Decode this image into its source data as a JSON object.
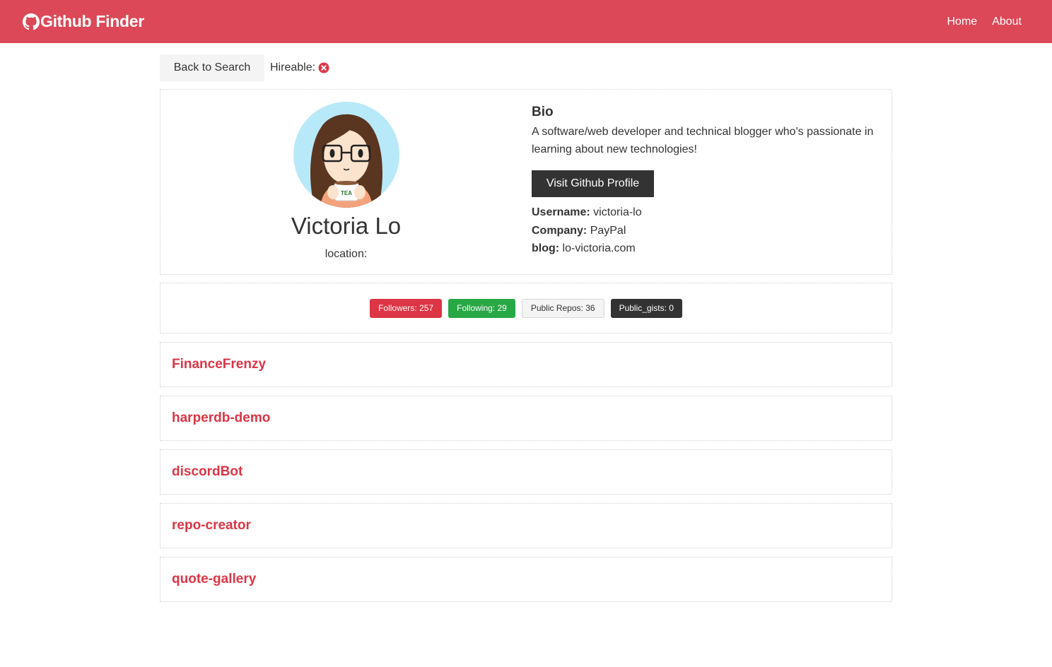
{
  "navbar": {
    "brand": "Github Finder",
    "brand_icon": "github-icon",
    "links": [
      "Home",
      "About"
    ],
    "color": "#dc4857"
  },
  "topbar": {
    "back_label": "Back to Search",
    "hireable_label": "Hireable:",
    "hireable_icon": "x-circle-icon"
  },
  "profile": {
    "name": "Victoria Lo",
    "location_label": "location:",
    "bio_title": "Bio",
    "bio": "A software/web developer and technical blogger who's passionate in learning about new technologies!",
    "visit_label": "Visit Github Profile",
    "username_label": "Username:",
    "username": "victoria-lo",
    "company_label": "Company:",
    "company": "PayPal",
    "blog_label": "blog:",
    "blog": "lo-victoria.com"
  },
  "stats": {
    "followers": "Followers: 257",
    "following": "Following: 29",
    "public_repos": "Public Repos: 36",
    "public_gists": "Public_gists: 0"
  },
  "repos": [
    "FinanceFrenzy",
    "harperdb-demo",
    "discordBot",
    "repo-creator",
    "quote-gallery"
  ],
  "colors": {
    "primary": "#dc3545",
    "success": "#28a745",
    "dark": "#333333",
    "light": "#f4f4f4"
  }
}
